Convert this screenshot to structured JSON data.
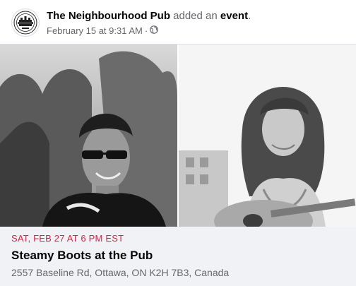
{
  "post": {
    "page_name": "The Neighbourhood Pub",
    "action_text": "added an",
    "event_word": "event",
    "period": ".",
    "timestamp": "February 15 at 9:31 AM",
    "separator": "·",
    "privacy_icon": "globe-icon"
  },
  "event": {
    "date": "SAT, FEB 27 AT 6 PM EST",
    "title": "Steamy Boots at the Pub",
    "location": "2557 Baseline Rd, Ottawa, ON K2H 7B3, Canada"
  },
  "colors": {
    "date_red": "#e41e3f",
    "secondary_text": "#65676b",
    "details_bg": "#f0f2f5"
  }
}
